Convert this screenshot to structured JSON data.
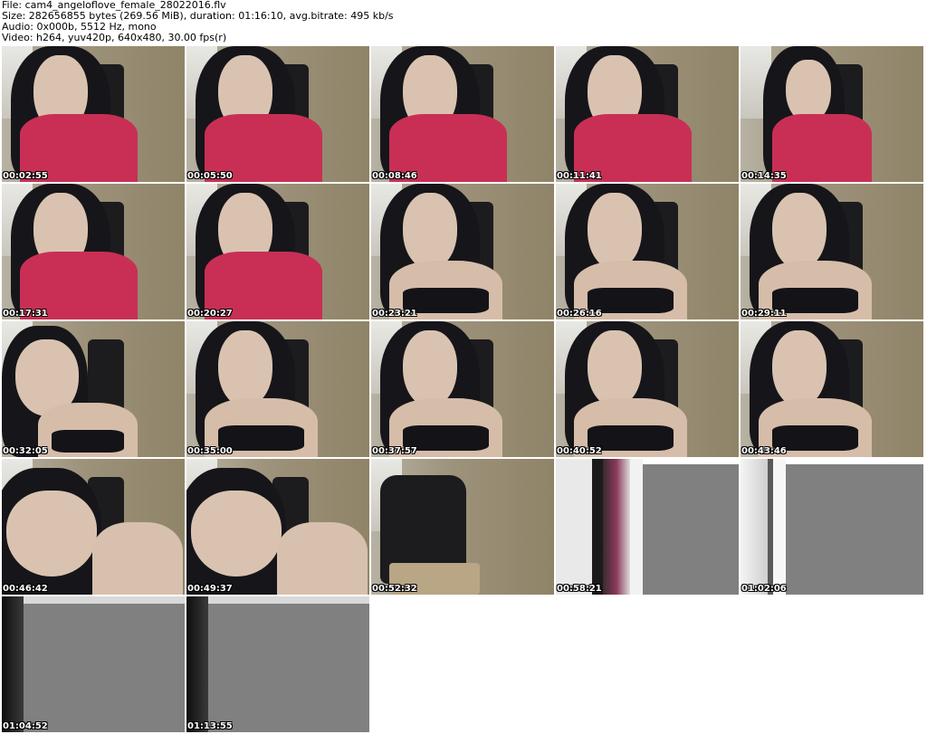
{
  "header": {
    "file_line": "File: cam4_angeloflove_female_28022016.flv",
    "size_line": "Size: 282656855 bytes (269.56 MiB), duration: 01:16:10, avg.bitrate: 495 kb/s",
    "audio_line": "Audio: 0x000b, 5512 Hz, mono",
    "video_line": "Video: h264, yuv420p, 640x480, 30.00 fps(r)"
  },
  "thumbnails": [
    {
      "timestamp": "00:02:55",
      "scene": "red-shirt"
    },
    {
      "timestamp": "00:05:50",
      "scene": "red-shirt"
    },
    {
      "timestamp": "00:08:46",
      "scene": "red-shirt"
    },
    {
      "timestamp": "00:11:41",
      "scene": "red-shirt"
    },
    {
      "timestamp": "00:14:35",
      "scene": "red-shirt-far"
    },
    {
      "timestamp": "00:17:31",
      "scene": "red-shirt"
    },
    {
      "timestamp": "00:20:27",
      "scene": "red-shirt"
    },
    {
      "timestamp": "00:23:21",
      "scene": "dark-top"
    },
    {
      "timestamp": "00:26:16",
      "scene": "dark-top"
    },
    {
      "timestamp": "00:29:11",
      "scene": "dark-top"
    },
    {
      "timestamp": "00:32:05",
      "scene": "dark-top-close"
    },
    {
      "timestamp": "00:35:00",
      "scene": "dark-top"
    },
    {
      "timestamp": "00:37:57",
      "scene": "dark-top"
    },
    {
      "timestamp": "00:40:52",
      "scene": "dark-top"
    },
    {
      "timestamp": "00:43:46",
      "scene": "dark-top"
    },
    {
      "timestamp": "00:46:42",
      "scene": "close-face"
    },
    {
      "timestamp": "00:49:37",
      "scene": "close-face"
    },
    {
      "timestamp": "00:52:32",
      "scene": "empty-chair"
    },
    {
      "timestamp": "00:58:21",
      "scene": "gray-pink"
    },
    {
      "timestamp": "01:02:06",
      "scene": "gray-white"
    },
    {
      "timestamp": "01:04:52",
      "scene": "gray-dark"
    },
    {
      "timestamp": "01:13:55",
      "scene": "gray-dark"
    }
  ],
  "colors": {
    "background": "#ffffff",
    "timestamp_text": "#ffffff",
    "gray_frame": "#808080",
    "shirt": "#c92f55"
  }
}
